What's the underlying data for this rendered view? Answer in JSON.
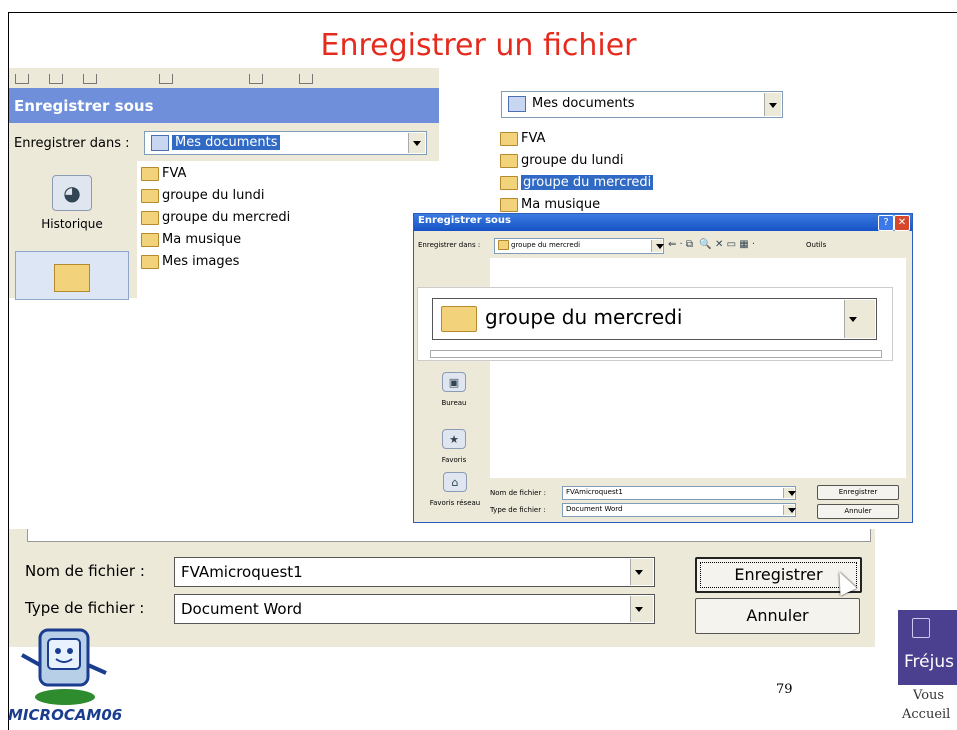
{
  "slide": {
    "title": "Enregistrer un fichier",
    "page_number": "79",
    "mascot_label": "MICROCAM06",
    "logo": {
      "text": "Fréjus",
      "tagline_line1": "Vous",
      "tagline_line2": "Accueil"
    }
  },
  "dialog1": {
    "title": "Enregistrer sous",
    "save_in_label": "Enregistrer dans :",
    "save_in_value": "Mes documents",
    "places": [
      {
        "label": "Historique",
        "icon": "history-icon"
      }
    ],
    "items": [
      {
        "name": "FVA",
        "icon": "folder-icon"
      },
      {
        "name": "groupe du lundi",
        "icon": "folder-icon"
      },
      {
        "name": "groupe du mercredi",
        "icon": "folder-icon"
      },
      {
        "name": "Ma musique",
        "icon": "music-folder-icon"
      },
      {
        "name": "Mes images",
        "icon": "pictures-folder-icon"
      }
    ]
  },
  "dropdown": {
    "value": "Mes documents",
    "items": [
      {
        "name": "FVA",
        "selected": false
      },
      {
        "name": "groupe du lundi",
        "selected": false
      },
      {
        "name": "groupe du mercredi",
        "selected": true
      },
      {
        "name": "Ma musique",
        "selected": false
      }
    ]
  },
  "dialog3": {
    "title": "Enregistrer sous",
    "save_in_label": "Enregistrer dans :",
    "save_in_value": "groupe du mercredi",
    "tools_label": "Outils",
    "zoom_value": "groupe du mercredi",
    "places": [
      {
        "label": "Bureau",
        "icon": "desktop-icon"
      },
      {
        "label": "Favoris",
        "icon": "favorites-icon"
      },
      {
        "label": "Favoris réseau",
        "icon": "network-icon"
      }
    ],
    "filename_label": "Nom de fichier :",
    "filename_value": "FVAmicroquest1",
    "filetype_label": "Type de fichier :",
    "filetype_value": "Document Word",
    "save_button": "Enregistrer",
    "cancel_button": "Annuler"
  },
  "dialog4": {
    "filename_label": "Nom de fichier :",
    "filename_value": "FVAmicroquest1",
    "filetype_label": "Type de fichier :",
    "filetype_value": "Document Word",
    "save_button": "Enregistrer",
    "cancel_button": "Annuler"
  },
  "colors": {
    "title_red": "#e52b1e",
    "xp_blue": "#1652c6",
    "selection_blue": "#316ac5",
    "dialog_bg": "#ece9d8"
  }
}
